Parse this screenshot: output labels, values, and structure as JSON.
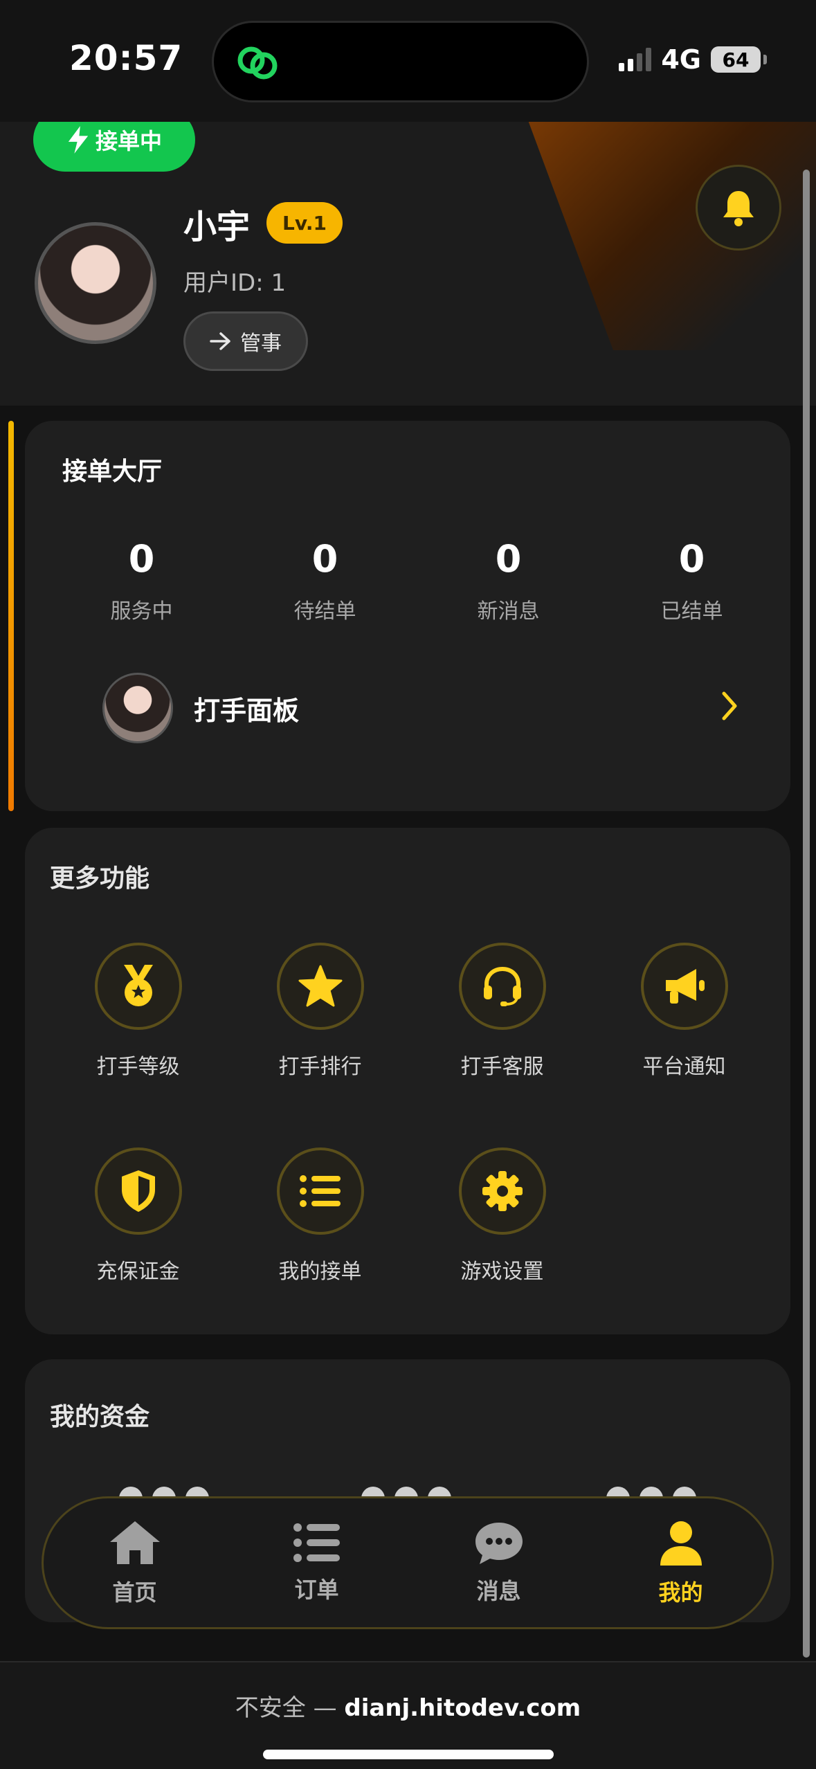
{
  "status_bar": {
    "time": "20:57",
    "network": "4G",
    "battery": "64"
  },
  "header": {
    "status_pill": "接单中",
    "name": "小宇",
    "level": "Lv.1",
    "user_id": "用户ID: 1",
    "manage_label": "管事",
    "icons": [
      "bolt-icon",
      "arrow-right-icon",
      "bell-icon"
    ]
  },
  "order_hall": {
    "title": "接单大厅",
    "stats": [
      {
        "value": "0",
        "label": "服务中"
      },
      {
        "value": "0",
        "label": "待结单"
      },
      {
        "value": "0",
        "label": "新消息"
      },
      {
        "value": "0",
        "label": "已结单"
      }
    ],
    "panel_label": "打手面板"
  },
  "more_features": {
    "title": "更多功能",
    "items": [
      {
        "label": "打手等级",
        "icon": "medal-icon"
      },
      {
        "label": "打手排行",
        "icon": "star-icon"
      },
      {
        "label": "打手客服",
        "icon": "headset-icon"
      },
      {
        "label": "平台通知",
        "icon": "megaphone-icon"
      },
      {
        "label": "充保证金",
        "icon": "shield-icon"
      },
      {
        "label": "我的接单",
        "icon": "list-icon"
      },
      {
        "label": "游戏设置",
        "icon": "gear-icon"
      }
    ]
  },
  "funds": {
    "title": "我的资金"
  },
  "tab_bar": {
    "tabs": [
      {
        "label": "首页",
        "icon": "home-icon"
      },
      {
        "label": "订单",
        "icon": "list-icon"
      },
      {
        "label": "消息",
        "icon": "chat-icon"
      },
      {
        "label": "我的",
        "icon": "user-icon",
        "active": true
      }
    ]
  },
  "browser": {
    "warning": "不安全 — ",
    "host": "dianj.hitodev.com"
  },
  "colors": {
    "accent": "#ffd21f",
    "green": "#13c64e",
    "level_badge": "#f7b500",
    "background": "#121212",
    "card": "#1f1f1f"
  }
}
